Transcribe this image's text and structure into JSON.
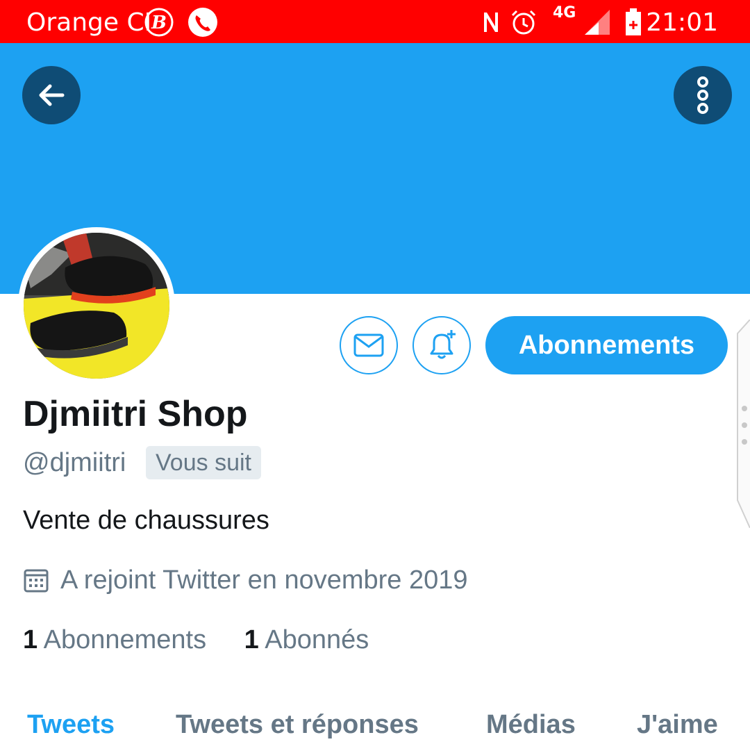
{
  "status_bar": {
    "carrier": "Orange CI",
    "time": "21:01",
    "network": "4G",
    "icons": [
      "b-icon",
      "phone-icon",
      "nfc-icon",
      "alarm-icon",
      "4g-icon",
      "signal-icon",
      "battery-icon"
    ],
    "color": "#ff0000"
  },
  "header": {
    "back_icon": "arrow-left-icon",
    "menu_icon": "more-vertical-icon",
    "banner_color": "#1da1f2"
  },
  "profile": {
    "name": "Djmiitri Shop",
    "handle": "@djmiitri",
    "follows_you": "Vous suit",
    "bio": "Vente de chaussures",
    "joined": "A rejoint Twitter en novembre 2019",
    "following_count": "1",
    "following_label": "Abonnements",
    "followers_count": "1",
    "followers_label": "Abonnés"
  },
  "actions": {
    "message_icon": "envelope-icon",
    "notify_icon": "bell-plus-icon",
    "follow_label": "Abonnements"
  },
  "tabs": [
    {
      "label": "Tweets",
      "active": true
    },
    {
      "label": "Tweets et réponses",
      "active": false
    },
    {
      "label": "Médias",
      "active": false
    },
    {
      "label": "J'aime",
      "active": false
    }
  ],
  "colors": {
    "accent": "#1da1f2",
    "text": "#14171a",
    "muted": "#657786",
    "dark_button": "#0f4c75"
  }
}
